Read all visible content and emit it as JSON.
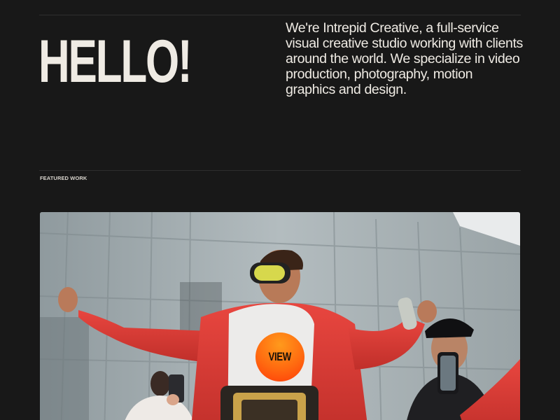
{
  "hero": {
    "heading": "HELLO!",
    "intro": "We're Intrepid Creative, a full-service visual creative studio working with clients around the world. We specialize in video production, photography, motion graphics and design."
  },
  "featured": {
    "label": "FEATURED WORK",
    "view_label": "VIEW",
    "accent_color": "#ff6a10"
  }
}
